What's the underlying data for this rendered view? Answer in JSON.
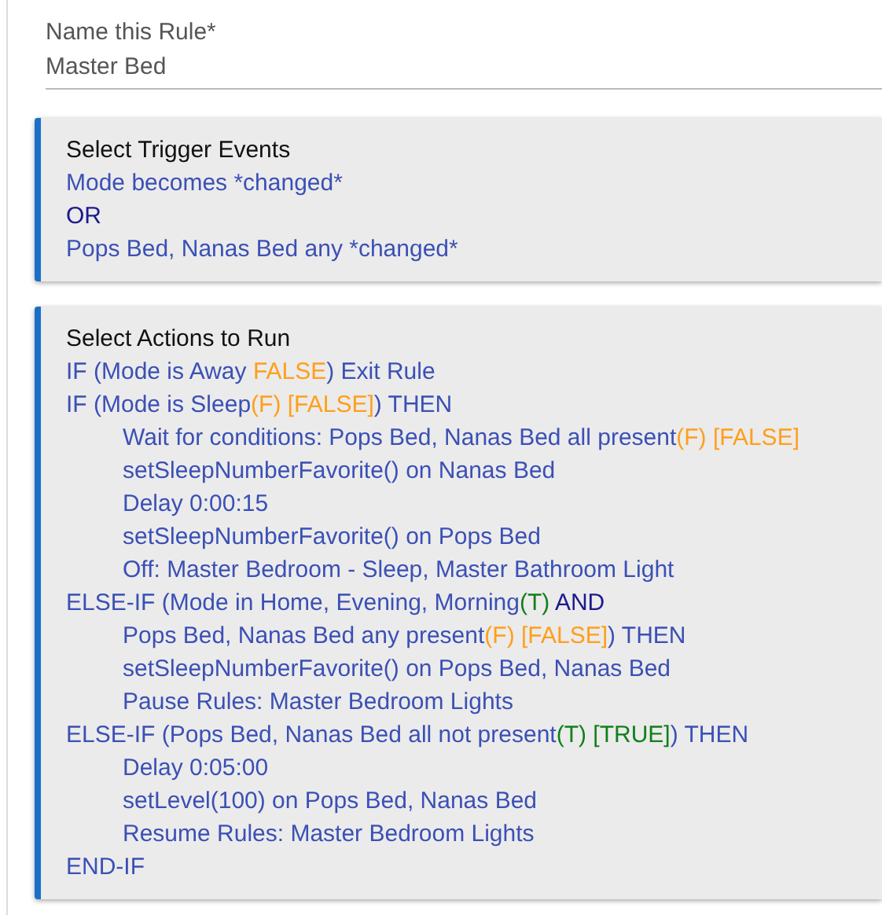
{
  "rule_name": {
    "label": "Name this Rule*",
    "value": "Master Bed"
  },
  "sections": [
    {
      "title": "Select Trigger Events",
      "lines": [
        {
          "segments": [
            {
              "text": "Mode becomes *changed*",
              "kind": "plain"
            }
          ]
        },
        {
          "segments": [
            {
              "text": "OR",
              "kind": "keyword"
            }
          ]
        },
        {
          "segments": [
            {
              "text": "Pops Bed, Nanas Bed any *changed*",
              "kind": "plain"
            }
          ]
        }
      ]
    },
    {
      "title": "Select Actions to Run",
      "lines": [
        {
          "segments": [
            {
              "text": "IF (Mode is Away ",
              "kind": "plain"
            },
            {
              "text": "FALSE",
              "kind": "false"
            },
            {
              "text": ") Exit Rule",
              "kind": "plain"
            }
          ]
        },
        {
          "segments": [
            {
              "text": "IF (Mode is Sleep",
              "kind": "plain"
            },
            {
              "text": "(F) [FALSE]",
              "kind": "false"
            },
            {
              "text": ") THEN",
              "kind": "plain"
            }
          ],
          "children": [
            {
              "segments": [
                {
                  "text": "Wait for conditions: Pops Bed, Nanas Bed all present",
                  "kind": "plain"
                },
                {
                  "text": "(F) [FALSE]",
                  "kind": "false"
                }
              ]
            },
            {
              "segments": [
                {
                  "text": "setSleepNumberFavorite() on Nanas Bed",
                  "kind": "plain"
                }
              ]
            },
            {
              "segments": [
                {
                  "text": "Delay 0:00:15",
                  "kind": "plain"
                }
              ]
            },
            {
              "segments": [
                {
                  "text": "setSleepNumberFavorite() on Pops Bed",
                  "kind": "plain"
                }
              ]
            },
            {
              "segments": [
                {
                  "text": "Off: Master Bedroom - Sleep, Master Bathroom Light",
                  "kind": "plain"
                }
              ]
            }
          ]
        },
        {
          "segments": [
            {
              "text": "ELSE-IF (Mode in Home, Evening, Morning",
              "kind": "plain"
            },
            {
              "text": "(T)",
              "kind": "true"
            },
            {
              "text": "  AND",
              "kind": "keyword"
            }
          ],
          "children": [
            {
              "segments": [
                {
                  "text": "Pops Bed, Nanas Bed any present",
                  "kind": "plain"
                },
                {
                  "text": "(F) [FALSE]",
                  "kind": "false"
                },
                {
                  "text": ") THEN",
                  "kind": "plain"
                }
              ]
            },
            {
              "segments": [
                {
                  "text": "setSleepNumberFavorite() on Pops Bed, Nanas Bed",
                  "kind": "plain"
                }
              ]
            },
            {
              "segments": [
                {
                  "text": "Pause Rules: Master Bedroom Lights",
                  "kind": "plain"
                }
              ]
            }
          ]
        },
        {
          "segments": [
            {
              "text": "ELSE-IF (Pops Bed, Nanas Bed all not present",
              "kind": "plain"
            },
            {
              "text": "(T) [TRUE]",
              "kind": "true"
            },
            {
              "text": ") THEN",
              "kind": "plain"
            }
          ],
          "children": [
            {
              "segments": [
                {
                  "text": "Delay 0:05:00",
                  "kind": "plain"
                }
              ]
            },
            {
              "segments": [
                {
                  "text": "setLevel(100) on Pops Bed, Nanas Bed",
                  "kind": "plain"
                }
              ]
            },
            {
              "segments": [
                {
                  "text": "Resume Rules: Master Bedroom Lights",
                  "kind": "plain"
                }
              ]
            }
          ]
        },
        {
          "segments": [
            {
              "text": "END-IF",
              "kind": "plain"
            }
          ]
        }
      ]
    }
  ]
}
